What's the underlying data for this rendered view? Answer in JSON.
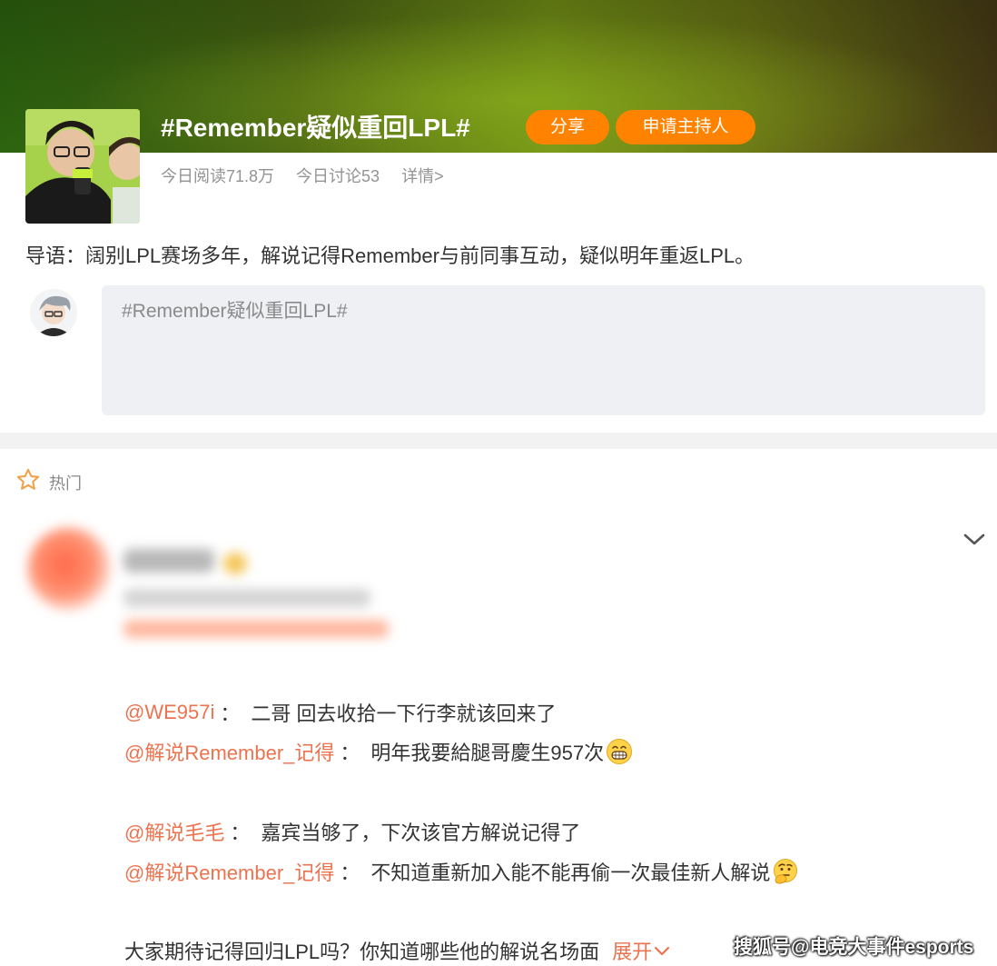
{
  "topic": {
    "title": "#Remember疑似重回LPL#",
    "share_label": "分享",
    "host_label": "申请主持人",
    "read_today": "今日阅读71.8万",
    "discuss_today": "今日讨论53",
    "details_label": "详情>"
  },
  "lead": "导语：阔别LPL赛场多年，解说记得Remember与前同事互动，疑似明年重返LPL。",
  "compose": {
    "text": "#Remember疑似重回LPL#"
  },
  "hot": {
    "label": "热门"
  },
  "comment": {
    "lines": [
      {
        "mention": "@WE957i",
        "sep": "：",
        "text": "二哥 回去收拾一下行李就该回来了",
        "emoji": ""
      },
      {
        "mention": "@解说Remember_记得",
        "sep": "：",
        "text": "明年我要給腿哥慶生957次",
        "emoji": "grin"
      },
      {
        "mention": "@解说毛毛",
        "sep": "：",
        "text": "嘉宾当够了，下次该官方解说记得了",
        "emoji": ""
      },
      {
        "mention": "@解说Remember_记得",
        "sep": "：",
        "text": "不知道重新加入能不能再偷一次最佳新人解说",
        "emoji": "thinking"
      }
    ],
    "question": "大家期待记得回归LPL吗？你知道哪些他的解说名场面",
    "expand_label": "展开"
  },
  "watermark": "搜狐号@电竞大事件esports",
  "colors": {
    "accent_orange": "#ff8200",
    "mention": "#eb7350",
    "compose_bg": "#eef0f3"
  },
  "icons": [
    "star-outline-icon",
    "chevron-down-icon",
    "grin-emoji-icon",
    "thinking-emoji-icon"
  ]
}
